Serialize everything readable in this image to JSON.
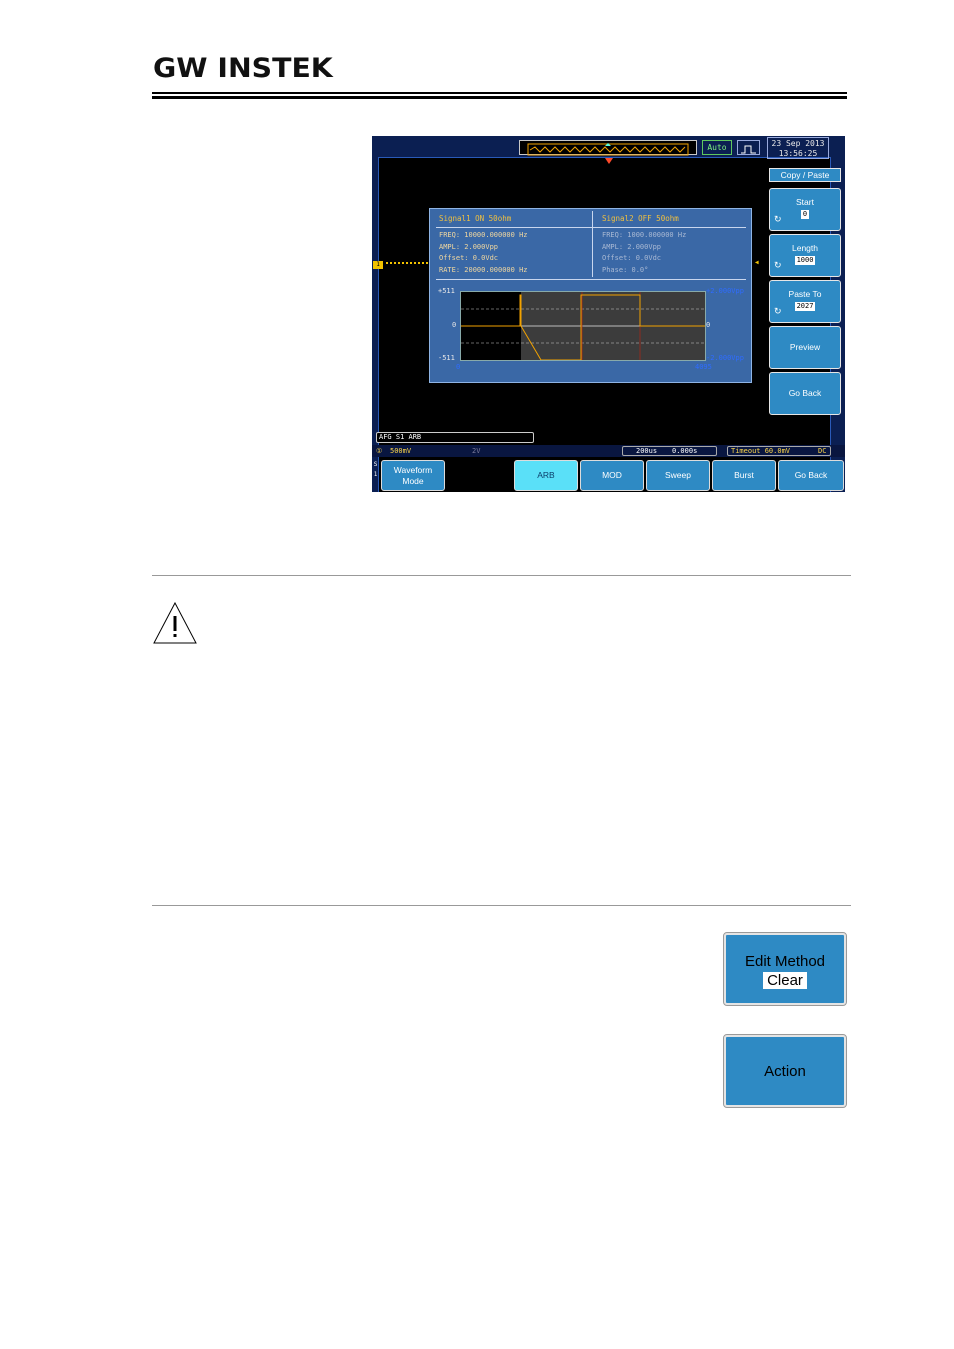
{
  "header": {
    "brand": "GW INSTEK"
  },
  "scope": {
    "auto_label": "Auto",
    "date": "23 Sep 2013",
    "time": "13:56:25",
    "side_menu": {
      "title": "Copy / Paste",
      "start_label": "Start",
      "start_value": "0",
      "length_label": "Length",
      "length_value": "1000",
      "paste_to_label": "Paste To",
      "paste_to_value": "2027",
      "preview_label": "Preview",
      "go_back_label": "Go Back"
    },
    "popup": {
      "signal1_header": "Signal1 ON 50ohm",
      "signal2_header": "Signal2 OFF 50ohm",
      "signal1_params": [
        "FREQ: 10000.000000 Hz",
        "AMPL: 2.000Vpp",
        "Offset: 0.0Vdc",
        "RATE: 20000.000000 Hz"
      ],
      "signal2_params": [
        "FREQ: 1000.000000 Hz",
        "AMPL: 2.000Vpp",
        "Offset: 0.0Vdc",
        "Phase: 0.0°"
      ],
      "plot_top_left": "+511",
      "plot_mid_left": "0",
      "plot_bot_left": "-511",
      "plot_x_start": "0",
      "plot_top_right": "+2.000Vpp",
      "plot_mid_right": "0",
      "plot_bot_right": "-2.000Vpp",
      "plot_x_end": "4095"
    },
    "status_line": "AFG S1 ARB",
    "bottom_status": {
      "ch1_scale": "500mV",
      "ch2_scale": "2V",
      "timebase": "200us",
      "position": "0.000s",
      "trigger": "Timeout 60.0mV",
      "coupling": "DC"
    },
    "bottom_menu": {
      "s1_tag": "S 1",
      "waveform_mode_line1": "Waveform",
      "waveform_mode_line2": "Mode",
      "arb": "ARB",
      "mod": "MOD",
      "sweep": "Sweep",
      "burst": "Burst",
      "go_back": "Go Back"
    }
  },
  "softkeys": {
    "edit_method_label": "Edit Method",
    "edit_method_value": "Clear",
    "action_label": "Action"
  }
}
